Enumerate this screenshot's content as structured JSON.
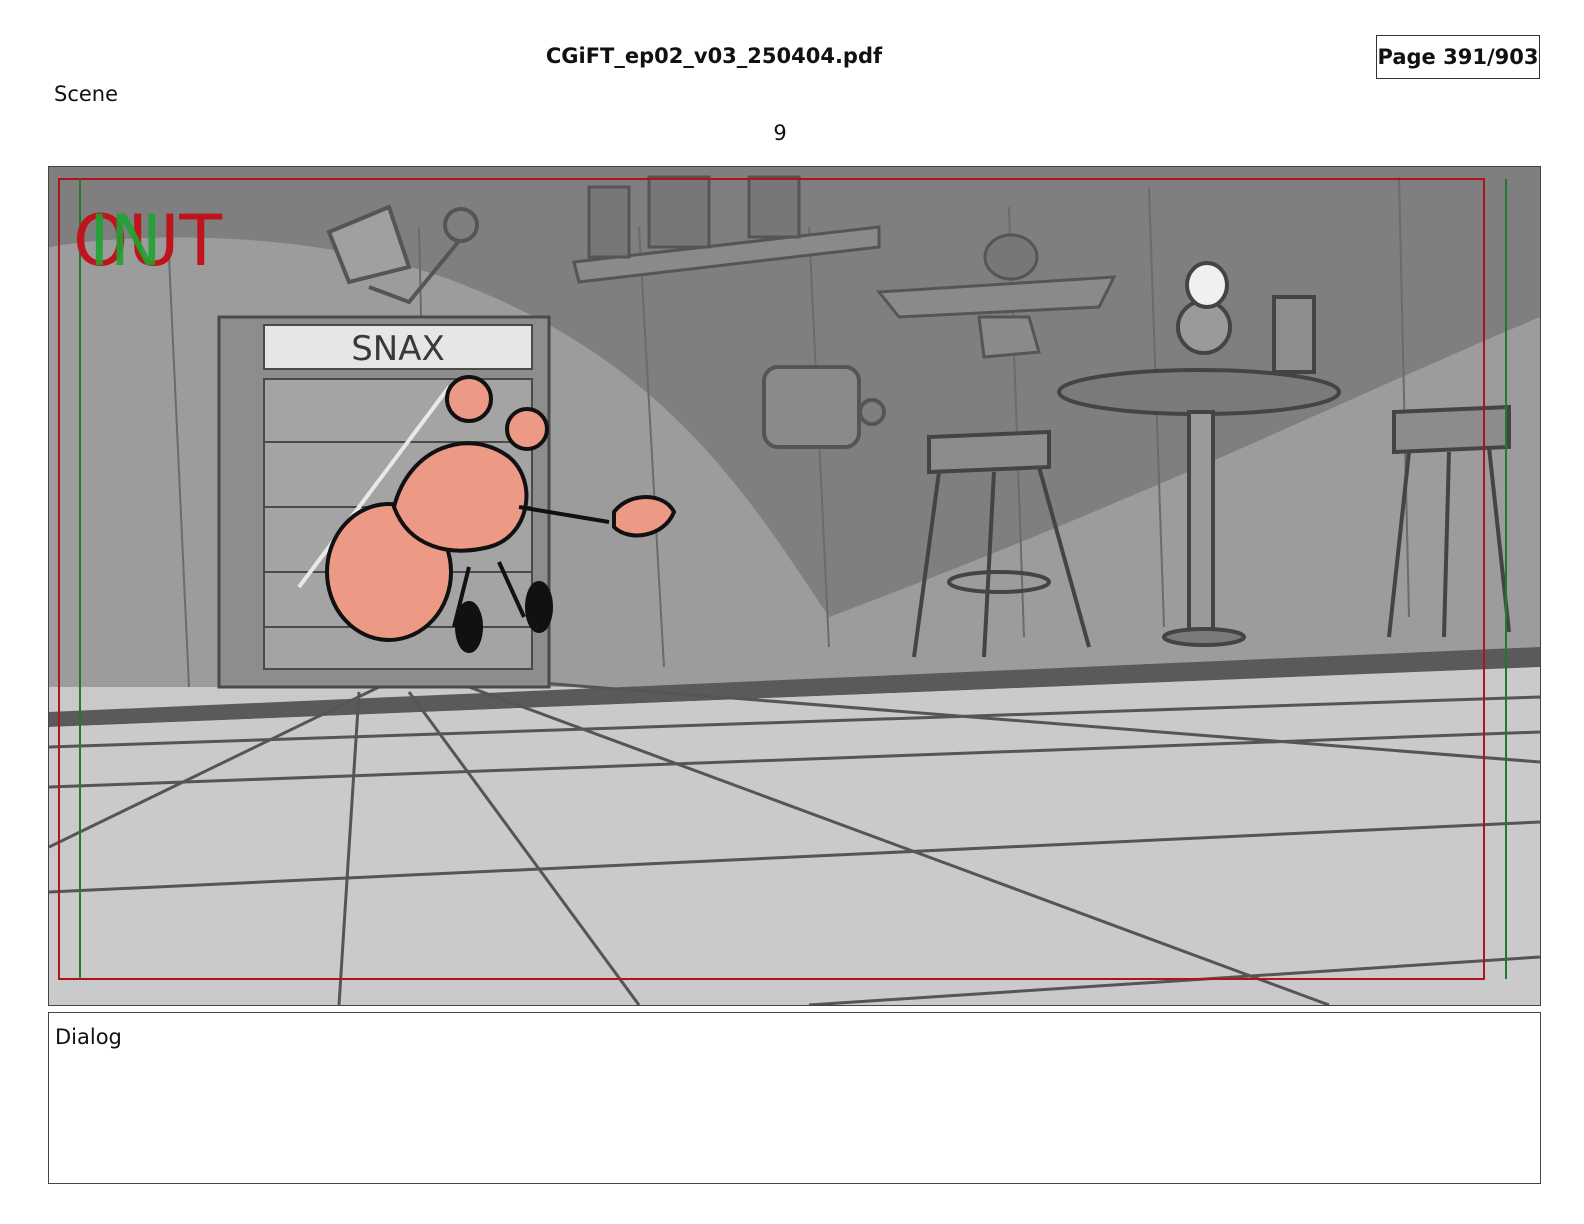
{
  "document": {
    "filename": "CGiFT_ep02_v03_250404.pdf",
    "page_label": "Page 391/903"
  },
  "scene": {
    "label": "Scene",
    "number": "9"
  },
  "panel": {
    "in_marker": "IN",
    "out_marker": "OUT",
    "sign_text": "SNAX",
    "colors": {
      "background_wall": "#8a8a8a",
      "floor": "#cacaca",
      "character_fill": "#ec9a86",
      "safe_area_red": "#b4121a",
      "safe_area_green": "#1f7a2c",
      "out_red": "#c0141c",
      "in_green": "#1fa332"
    }
  },
  "dialog": {
    "label": "Dialog",
    "text": ""
  }
}
